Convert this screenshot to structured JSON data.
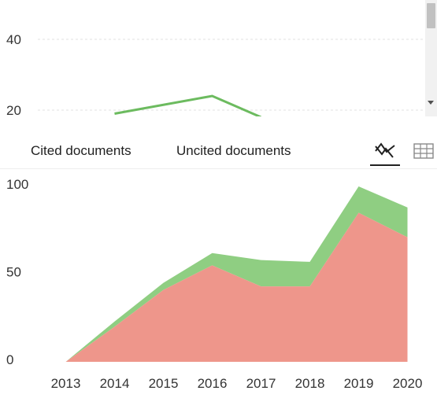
{
  "tabs": {
    "cited_label": "Cited documents",
    "uncited_label": "Uncited documents",
    "chart_view_icon": "line-chart-icon",
    "table_view_icon": "table-grid-icon"
  },
  "colors": {
    "cited": "#ee968b",
    "uncited": "#8fce82",
    "top_line": "#6cbb5f",
    "grid": "#e0e0e0",
    "axis_text": "#333333"
  },
  "chart_data": [
    {
      "type": "line",
      "partially_visible": true,
      "yticks": [
        20,
        40
      ],
      "series": [
        {
          "points": [
            [
              2014,
              19
            ],
            [
              2016,
              24
            ],
            [
              2017,
              18
            ]
          ]
        }
      ]
    },
    {
      "type": "area",
      "stacked": true,
      "x": [
        2013,
        2014,
        2015,
        2016,
        2017,
        2018,
        2019,
        2020
      ],
      "ylim": [
        0,
        100
      ],
      "yticks": [
        0,
        50,
        100
      ],
      "xlabel": "",
      "ylabel": "",
      "series": [
        {
          "name": "Cited documents",
          "values": [
            0,
            20,
            41,
            55,
            43,
            43,
            85,
            71
          ]
        },
        {
          "name": "Uncited documents",
          "values": [
            0,
            3,
            4,
            7,
            15,
            14,
            15,
            17
          ]
        }
      ]
    }
  ]
}
